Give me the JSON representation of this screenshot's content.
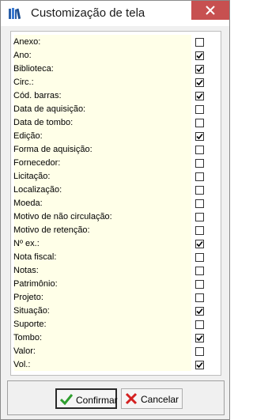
{
  "window": {
    "title": "Customização de tela",
    "icon": "books-icon",
    "close_icon": "close-icon"
  },
  "fields": [
    {
      "label": "Anexo:",
      "checked": false
    },
    {
      "label": "Ano:",
      "checked": true
    },
    {
      "label": "Biblioteca:",
      "checked": true
    },
    {
      "label": "Circ.:",
      "checked": true
    },
    {
      "label": "Cód. barras:",
      "checked": true
    },
    {
      "label": "Data de aquisição:",
      "checked": false
    },
    {
      "label": "Data de tombo:",
      "checked": false
    },
    {
      "label": "Edição:",
      "checked": true
    },
    {
      "label": "Forma de aquisição:",
      "checked": false
    },
    {
      "label": "Fornecedor:",
      "checked": false
    },
    {
      "label": "Licitação:",
      "checked": false
    },
    {
      "label": "Localização:",
      "checked": false
    },
    {
      "label": "Moeda:",
      "checked": false
    },
    {
      "label": "Motivo de não circulação:",
      "checked": false
    },
    {
      "label": "Motivo de retenção:",
      "checked": false
    },
    {
      "label": "Nº ex.:",
      "checked": true
    },
    {
      "label": "Nota fiscal:",
      "checked": false
    },
    {
      "label": "Notas:",
      "checked": false
    },
    {
      "label": "Patrimônio:",
      "checked": false
    },
    {
      "label": "Projeto:",
      "checked": false
    },
    {
      "label": "Situação:",
      "checked": true
    },
    {
      "label": "Suporte:",
      "checked": false
    },
    {
      "label": "Tombo:",
      "checked": true
    },
    {
      "label": "Valor:",
      "checked": false
    },
    {
      "label": "Vol.:",
      "checked": true
    }
  ],
  "buttons": {
    "confirm_label": "Confirmar",
    "confirm_icon": "checkmark-icon",
    "cancel_label": "Cancelar",
    "cancel_icon": "x-icon"
  },
  "colors": {
    "list_background": "#ffffe8",
    "close_button": "#c75050",
    "confirm_check": "#2e9e2e",
    "cancel_x": "#d42020"
  }
}
